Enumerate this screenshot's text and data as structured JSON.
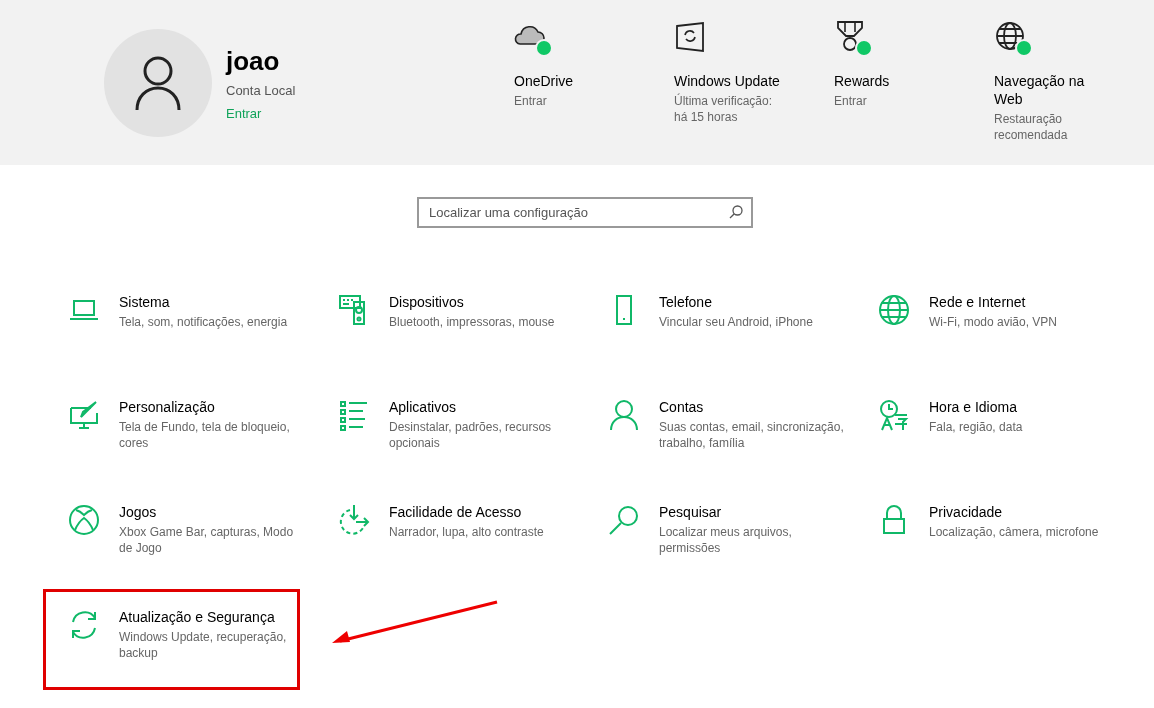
{
  "account": {
    "name": "joao",
    "type": "Conta Local",
    "link": "Entrar"
  },
  "status_items": [
    {
      "title": "OneDrive",
      "subtitle": "Entrar",
      "status_dot": true
    },
    {
      "title": "Windows Update",
      "subtitle": "Última verificação: há 15 horas",
      "status_dot": false
    },
    {
      "title": "Rewards",
      "subtitle": "Entrar",
      "status_dot": true
    },
    {
      "title": "Navegação na Web",
      "subtitle": "Restauração recomendada",
      "status_dot": true
    }
  ],
  "search": {
    "placeholder": "Localizar uma configuração"
  },
  "categories": [
    {
      "title": "Sistema",
      "description": "Tela, som, notificações, energia",
      "highlighted": false
    },
    {
      "title": "Dispositivos",
      "description": "Bluetooth, impressoras, mouse",
      "highlighted": false
    },
    {
      "title": "Telefone",
      "description": "Vincular seu Android, iPhone",
      "highlighted": false
    },
    {
      "title": "Rede e Internet",
      "description": "Wi-Fi, modo avião, VPN",
      "highlighted": false
    },
    {
      "title": "Personalização",
      "description": "Tela de Fundo, tela de bloqueio, cores",
      "highlighted": false
    },
    {
      "title": "Aplicativos",
      "description": "Desinstalar, padrões, recursos opcionais",
      "highlighted": false
    },
    {
      "title": "Contas",
      "description": "Suas contas, email, sincronização, trabalho, família",
      "highlighted": false
    },
    {
      "title": "Hora e Idioma",
      "description": "Fala, região, data",
      "highlighted": false
    },
    {
      "title": "Jogos",
      "description": "Xbox Game Bar, capturas, Modo de Jogo",
      "highlighted": false
    },
    {
      "title": "Facilidade de Acesso",
      "description": "Narrador, lupa, alto contraste",
      "highlighted": false
    },
    {
      "title": "Pesquisar",
      "description": "Localizar meus arquivos, permissões",
      "highlighted": false
    },
    {
      "title": "Privacidade",
      "description": "Localização, câmera, microfone",
      "highlighted": false
    },
    {
      "title": "Atualização e Segurança",
      "description": "Windows Update, recuperação, backup",
      "highlighted": true
    }
  ],
  "annotation_arrow": true
}
